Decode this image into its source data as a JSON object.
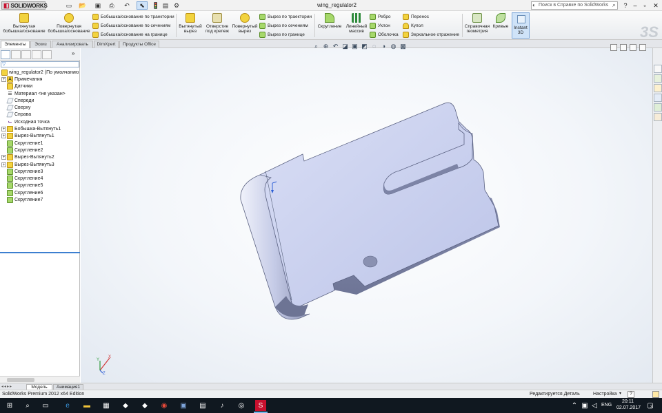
{
  "app": {
    "brand": "SOLIDWORKS",
    "window_title": "wing_regulator2",
    "search_placeholder": "Поиск в Справке по SolidWorks"
  },
  "ribbon": {
    "extruded_boss": "Вытянутая бобышка/основание",
    "revolved_boss": "Повернутая бобышка/основание",
    "swept_boss": "Бобышка/основание по траектории",
    "lofted_boss": "Бобышка/основание по сечениям",
    "boundary_boss": "Бобышка/основание на границе",
    "extruded_cut": "Вытянутый вырез",
    "hole_wizard": "Отверстие под крепеж",
    "revolved_cut": "Повернутый вырез",
    "swept_cut": "Вырез по траектории",
    "lofted_cut": "Вырез по сечениям",
    "boundary_cut": "Вырез по границе",
    "fillet": "Скругление",
    "linear_pattern": "Линейный массив",
    "rib": "Ребро",
    "draft": "Уклон",
    "shell": "Оболочка",
    "wrap": "Перенос",
    "dome": "Купол",
    "mirror": "Зеркальное отражение",
    "ref_geometry": "Справочная геометрия",
    "curves": "Кривые",
    "instant3d": "Instant 3D"
  },
  "command_tabs": [
    "Элементы",
    "Эскиз",
    "Анализировать",
    "DimXpert",
    "Продукты Office"
  ],
  "feature_tree": {
    "root": "wing_regulator2  (По умолчанию",
    "items": [
      {
        "label": "Примечания",
        "icon": "annotations-icon",
        "exp": true
      },
      {
        "label": "Датчики",
        "icon": "sensors-icon",
        "exp": false
      },
      {
        "label": "Материал <не указан>",
        "icon": "material-icon",
        "exp": false
      },
      {
        "label": "Спереди",
        "icon": "plane-icon",
        "exp": false
      },
      {
        "label": "Сверху",
        "icon": "plane-icon",
        "exp": false
      },
      {
        "label": "Справа",
        "icon": "plane-icon",
        "exp": false
      },
      {
        "label": "Исходная точка",
        "icon": "origin-icon",
        "exp": false
      },
      {
        "label": "Бобышка-Вытянуть1",
        "icon": "extrude-icon",
        "exp": true
      },
      {
        "label": "Вырез-Вытянуть1",
        "icon": "cut-icon",
        "exp": true
      },
      {
        "label": "Скругление1",
        "icon": "fillet-icon",
        "exp": false
      },
      {
        "label": "Скругление2",
        "icon": "fillet-icon",
        "exp": false
      },
      {
        "label": "Вырез-Вытянуть2",
        "icon": "cut-icon",
        "exp": true
      },
      {
        "label": "Вырез-Вытянуть3",
        "icon": "cut-icon",
        "exp": true
      },
      {
        "label": "Скругление3",
        "icon": "fillet-icon",
        "exp": false
      },
      {
        "label": "Скругление4",
        "icon": "fillet-icon",
        "exp": false
      },
      {
        "label": "Скругление5",
        "icon": "fillet-icon",
        "exp": false
      },
      {
        "label": "Скругление6",
        "icon": "fillet-icon",
        "exp": false
      },
      {
        "label": "Скругление7",
        "icon": "fillet-icon",
        "exp": false
      }
    ]
  },
  "model_tabs": [
    "Модель",
    "Анимация1"
  ],
  "status": {
    "edition": "SolidWorks Premium 2012 x64 Edition",
    "editing": "Редактируется Деталь",
    "settings": "Настройка",
    "help": "?"
  },
  "taskbar": {
    "lang": "ENG",
    "time": "20:11",
    "date": "02.07.2017",
    "notify_count": "3"
  },
  "triad": {
    "x": "X",
    "y": "Y",
    "z": "Z"
  },
  "colors": {
    "part_top": "#c9d0ee",
    "part_side": "#8a91b1",
    "accent": "#3c7fd0",
    "taskbar": "#101820"
  }
}
